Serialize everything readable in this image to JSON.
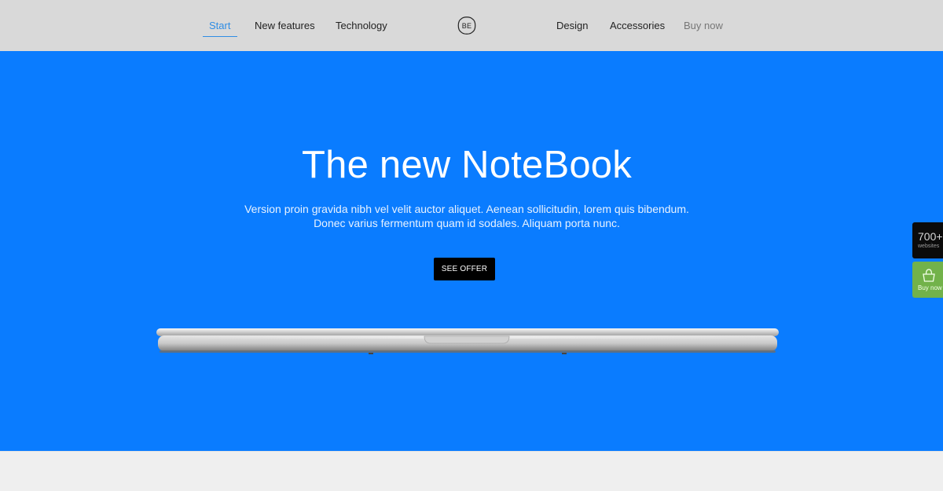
{
  "nav": {
    "left": [
      {
        "label": "Start"
      },
      {
        "label": "New features"
      },
      {
        "label": "Technology"
      }
    ],
    "right": [
      {
        "label": "Design"
      },
      {
        "label": "Accessories"
      },
      {
        "label": "Buy now"
      }
    ],
    "logo_text": "BE"
  },
  "hero": {
    "title": "The new NoteBook",
    "subtitle_line1": "Version proin gravida nibh vel velit auctor aliquet. Aenean sollicitudin, lorem quis bibendum.",
    "subtitle_line2": "Donec varius fermentum quam id sodales. Aliquam porta nunc.",
    "button_label": "SEE OFFER"
  },
  "side": {
    "websites_count": "700+",
    "websites_label": "websites",
    "buy_label": "Buy now"
  },
  "colors": {
    "hero_background": "#0a7cff",
    "active_nav": "#2f8de4",
    "buy_widget": "#72b24a",
    "header_background": "#d9d9d9"
  }
}
